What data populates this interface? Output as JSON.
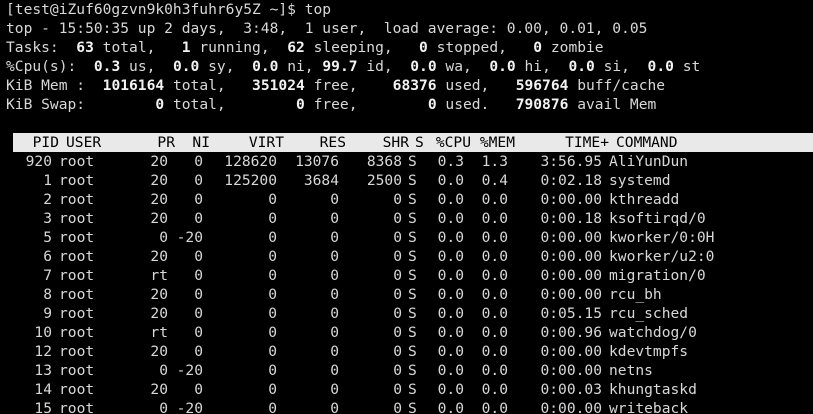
{
  "prompt": "[test@iZuf60gzvn9k0h3fuhr6y5Z ~]$ top",
  "summary": {
    "top": {
      "label": "top - 15:50:35 up 2 days,  3:48,  1 user,  load average: 0.00, 0.01, 0.05"
    },
    "tasks": {
      "label": "Tasks:",
      "total": "63",
      "total_label": "total,",
      "running": "1",
      "running_label": "running,",
      "sleeping": "62",
      "sleeping_label": "sleeping,",
      "stopped": "0",
      "stopped_label": "stopped,",
      "zombie": "0",
      "zombie_label": "zombie"
    },
    "cpu": {
      "label": "%Cpu(s):",
      "us": "0.3",
      "us_label": "us,",
      "sy": "0.0",
      "sy_label": "sy,",
      "ni": "0.0",
      "ni_label": "ni,",
      "id": "99.7",
      "id_label": "id,",
      "wa": "0.0",
      "wa_label": "wa,",
      "hi": "0.0",
      "hi_label": "hi,",
      "si": "0.0",
      "si_label": "si,",
      "st": "0.0",
      "st_label": "st"
    },
    "mem": {
      "label": "KiB Mem :",
      "total": "1016164",
      "total_label": "total,",
      "free": "351024",
      "free_label": "free,",
      "used": "68376",
      "used_label": "used,",
      "buff": "596764",
      "buff_label": "buff/cache"
    },
    "swap": {
      "label": "KiB Swap:",
      "total": "0",
      "total_label": "total,",
      "free": "0",
      "free_label": "free,",
      "used": "0",
      "used_label": "used.",
      "avail": "790876",
      "avail_label": "avail Mem"
    }
  },
  "table": {
    "headers": {
      "pid": "PID",
      "user": "USER",
      "pr": "PR",
      "ni": "NI",
      "virt": "VIRT",
      "res": "RES",
      "shr": "SHR",
      "s": "S",
      "cpu": "%CPU",
      "mem": "%MEM",
      "time": "TIME+",
      "cmd": "COMMAND"
    },
    "rows": [
      {
        "pid": "920",
        "user": "root",
        "pr": "20",
        "ni": "0",
        "virt": "128620",
        "res": "13076",
        "shr": "8368",
        "s": "S",
        "cpu": "0.3",
        "mem": "1.3",
        "time": "3:56.95",
        "cmd": "AliYunDun"
      },
      {
        "pid": "1",
        "user": "root",
        "pr": "20",
        "ni": "0",
        "virt": "125200",
        "res": "3684",
        "shr": "2500",
        "s": "S",
        "cpu": "0.0",
        "mem": "0.4",
        "time": "0:02.18",
        "cmd": "systemd"
      },
      {
        "pid": "2",
        "user": "root",
        "pr": "20",
        "ni": "0",
        "virt": "0",
        "res": "0",
        "shr": "0",
        "s": "S",
        "cpu": "0.0",
        "mem": "0.0",
        "time": "0:00.00",
        "cmd": "kthreadd"
      },
      {
        "pid": "3",
        "user": "root",
        "pr": "20",
        "ni": "0",
        "virt": "0",
        "res": "0",
        "shr": "0",
        "s": "S",
        "cpu": "0.0",
        "mem": "0.0",
        "time": "0:00.18",
        "cmd": "ksoftirqd/0"
      },
      {
        "pid": "5",
        "user": "root",
        "pr": "0",
        "ni": "-20",
        "virt": "0",
        "res": "0",
        "shr": "0",
        "s": "S",
        "cpu": "0.0",
        "mem": "0.0",
        "time": "0:00.00",
        "cmd": "kworker/0:0H"
      },
      {
        "pid": "6",
        "user": "root",
        "pr": "20",
        "ni": "0",
        "virt": "0",
        "res": "0",
        "shr": "0",
        "s": "S",
        "cpu": "0.0",
        "mem": "0.0",
        "time": "0:00.00",
        "cmd": "kworker/u2:0"
      },
      {
        "pid": "7",
        "user": "root",
        "pr": "rt",
        "ni": "0",
        "virt": "0",
        "res": "0",
        "shr": "0",
        "s": "S",
        "cpu": "0.0",
        "mem": "0.0",
        "time": "0:00.00",
        "cmd": "migration/0"
      },
      {
        "pid": "8",
        "user": "root",
        "pr": "20",
        "ni": "0",
        "virt": "0",
        "res": "0",
        "shr": "0",
        "s": "S",
        "cpu": "0.0",
        "mem": "0.0",
        "time": "0:00.00",
        "cmd": "rcu_bh"
      },
      {
        "pid": "9",
        "user": "root",
        "pr": "20",
        "ni": "0",
        "virt": "0",
        "res": "0",
        "shr": "0",
        "s": "S",
        "cpu": "0.0",
        "mem": "0.0",
        "time": "0:05.15",
        "cmd": "rcu_sched"
      },
      {
        "pid": "10",
        "user": "root",
        "pr": "rt",
        "ni": "0",
        "virt": "0",
        "res": "0",
        "shr": "0",
        "s": "S",
        "cpu": "0.0",
        "mem": "0.0",
        "time": "0:00.96",
        "cmd": "watchdog/0"
      },
      {
        "pid": "12",
        "user": "root",
        "pr": "20",
        "ni": "0",
        "virt": "0",
        "res": "0",
        "shr": "0",
        "s": "S",
        "cpu": "0.0",
        "mem": "0.0",
        "time": "0:00.00",
        "cmd": "kdevtmpfs"
      },
      {
        "pid": "13",
        "user": "root",
        "pr": "0",
        "ni": "-20",
        "virt": "0",
        "res": "0",
        "shr": "0",
        "s": "S",
        "cpu": "0.0",
        "mem": "0.0",
        "time": "0:00.00",
        "cmd": "netns"
      },
      {
        "pid": "14",
        "user": "root",
        "pr": "20",
        "ni": "0",
        "virt": "0",
        "res": "0",
        "shr": "0",
        "s": "S",
        "cpu": "0.0",
        "mem": "0.0",
        "time": "0:00.03",
        "cmd": "khungtaskd"
      },
      {
        "pid": "15",
        "user": "root",
        "pr": "0",
        "ni": "-20",
        "virt": "0",
        "res": "0",
        "shr": "0",
        "s": "S",
        "cpu": "0.0",
        "mem": "0.0",
        "time": "0:00.00",
        "cmd": "writeback"
      }
    ]
  }
}
